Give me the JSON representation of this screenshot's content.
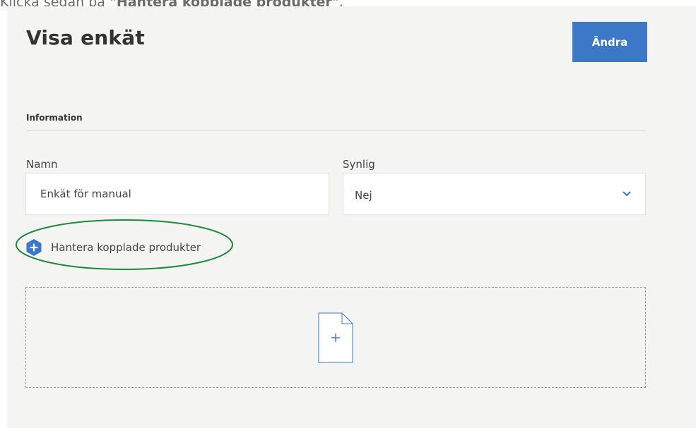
{
  "instruction": {
    "prefix": "Klicka sedan på ",
    "emphasis": "\"Hantera kopplade produkter\"",
    "suffix": "."
  },
  "page": {
    "title": "Visa enkät",
    "edit_button": "Ändra"
  },
  "section": {
    "title": "Information"
  },
  "fields": {
    "name": {
      "label": "Namn",
      "value": "Enkät för manual"
    },
    "visible": {
      "label": "Synlig",
      "value": "Nej"
    }
  },
  "manage_link": {
    "label": "Hantera kopplade produkter",
    "icon": "plus-hexagon-icon"
  },
  "dropzone": {
    "icon": "add-file-icon"
  },
  "colors": {
    "accent": "#3d78c8",
    "highlight": "#1f8a3c",
    "panel_bg": "#f4f4f2"
  }
}
